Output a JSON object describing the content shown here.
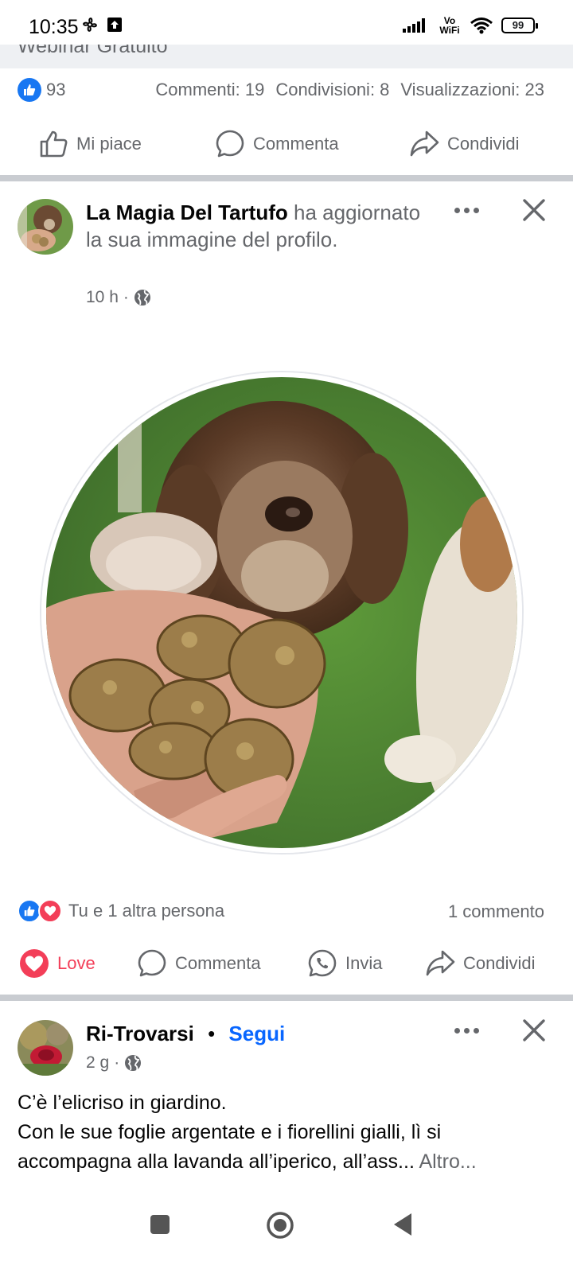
{
  "status_bar": {
    "time": "10:35",
    "network": "Vo WiFi",
    "battery": "99"
  },
  "previous_post": {
    "cut_title": "Webinar Gratuito",
    "likes": "93",
    "comments": "Commenti: 19",
    "shares": "Condivisioni: 8",
    "views": "Visualizzazioni: 23",
    "actions": {
      "like": "Mi piace",
      "comment": "Commenta",
      "share": "Condividi"
    }
  },
  "post": {
    "author": "La Magia Del Tartufo",
    "action_text": " ha aggiornato la sua immagine del profilo.",
    "time": "10 h",
    "privacy_icon": "globe-icon",
    "reaction_summary": "Tu e 1 altra persona",
    "comment_count": "1 commento",
    "actions": {
      "love": "Love",
      "comment": "Commenta",
      "send": "Invia",
      "share": "Condividi"
    }
  },
  "next_post": {
    "author": "Ri-Trovarsi",
    "separator": "•",
    "follow": "Segui",
    "time": "2 g",
    "text_line1": "C’è l’elicriso in giardino.",
    "text_line2": "Con le sue foglie argentate e i fiorellini gialli, lì si accompagna alla lavanda all’iperico, all’ass...",
    "more": " Altro..."
  },
  "colors": {
    "facebook_blue": "#1877f2",
    "love_red": "#f33e58",
    "secondary_text": "#65676b",
    "link_blue": "#0866ff"
  }
}
